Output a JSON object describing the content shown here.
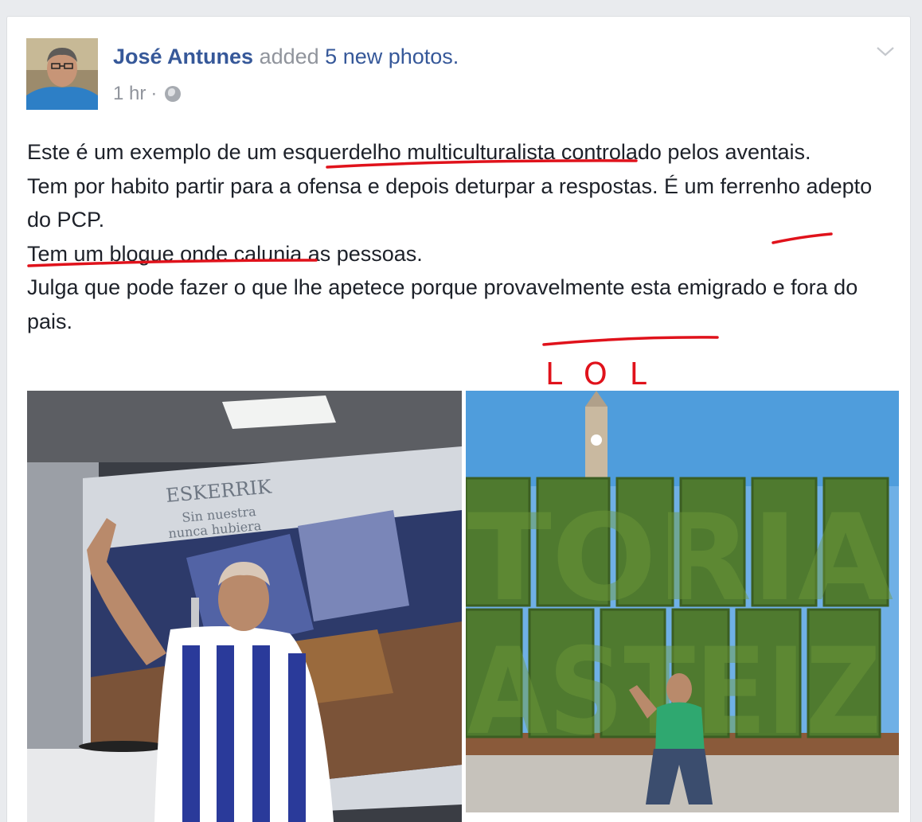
{
  "post": {
    "author": "José Antunes",
    "action": "added",
    "photo_count": "5 new photos.",
    "time": "1 hr",
    "separator": "·",
    "privacy_icon": "globe-icon",
    "menu_icon": "chevron-down-icon",
    "paragraphs": [
      "Este é um exemplo de um esquerdelho multiculturalista controlado pelos aventais.",
      "Tem por habito partir para a ofensa e depois deturpar a respostas. É um ferrenho adepto do PCP.",
      "Tem um blogue onde calunia as pessoas.",
      "Julga que pode fazer o que lhe apetece porque provavelmente esta emigrado e fora do pais."
    ],
    "annotation": {
      "handwritten_text": "LOL",
      "color": "#e0121b"
    }
  },
  "photos": [
    {
      "name": "photo-stadium-store",
      "sign_line1": "ESKERRIK",
      "sign_line2": "Sin nuestra",
      "sign_line3": "nunca hubiera"
    },
    {
      "name": "photo-hedge-letters",
      "hedge_line1": "TORIA",
      "hedge_line2": "ASTEIZ"
    }
  ],
  "colors": {
    "link": "#365899",
    "text": "#1d2129",
    "meta": "#90949c",
    "background": "#e9ebee",
    "card": "#ffffff"
  }
}
